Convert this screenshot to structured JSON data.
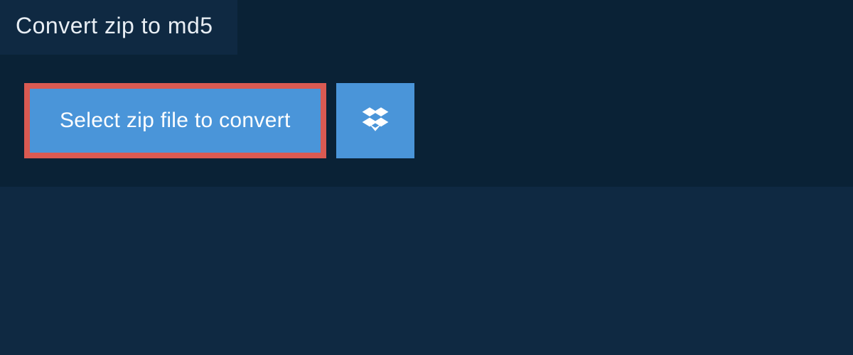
{
  "tab": {
    "title": "Convert zip to md5"
  },
  "actions": {
    "select_label": "Select zip file to convert"
  }
}
